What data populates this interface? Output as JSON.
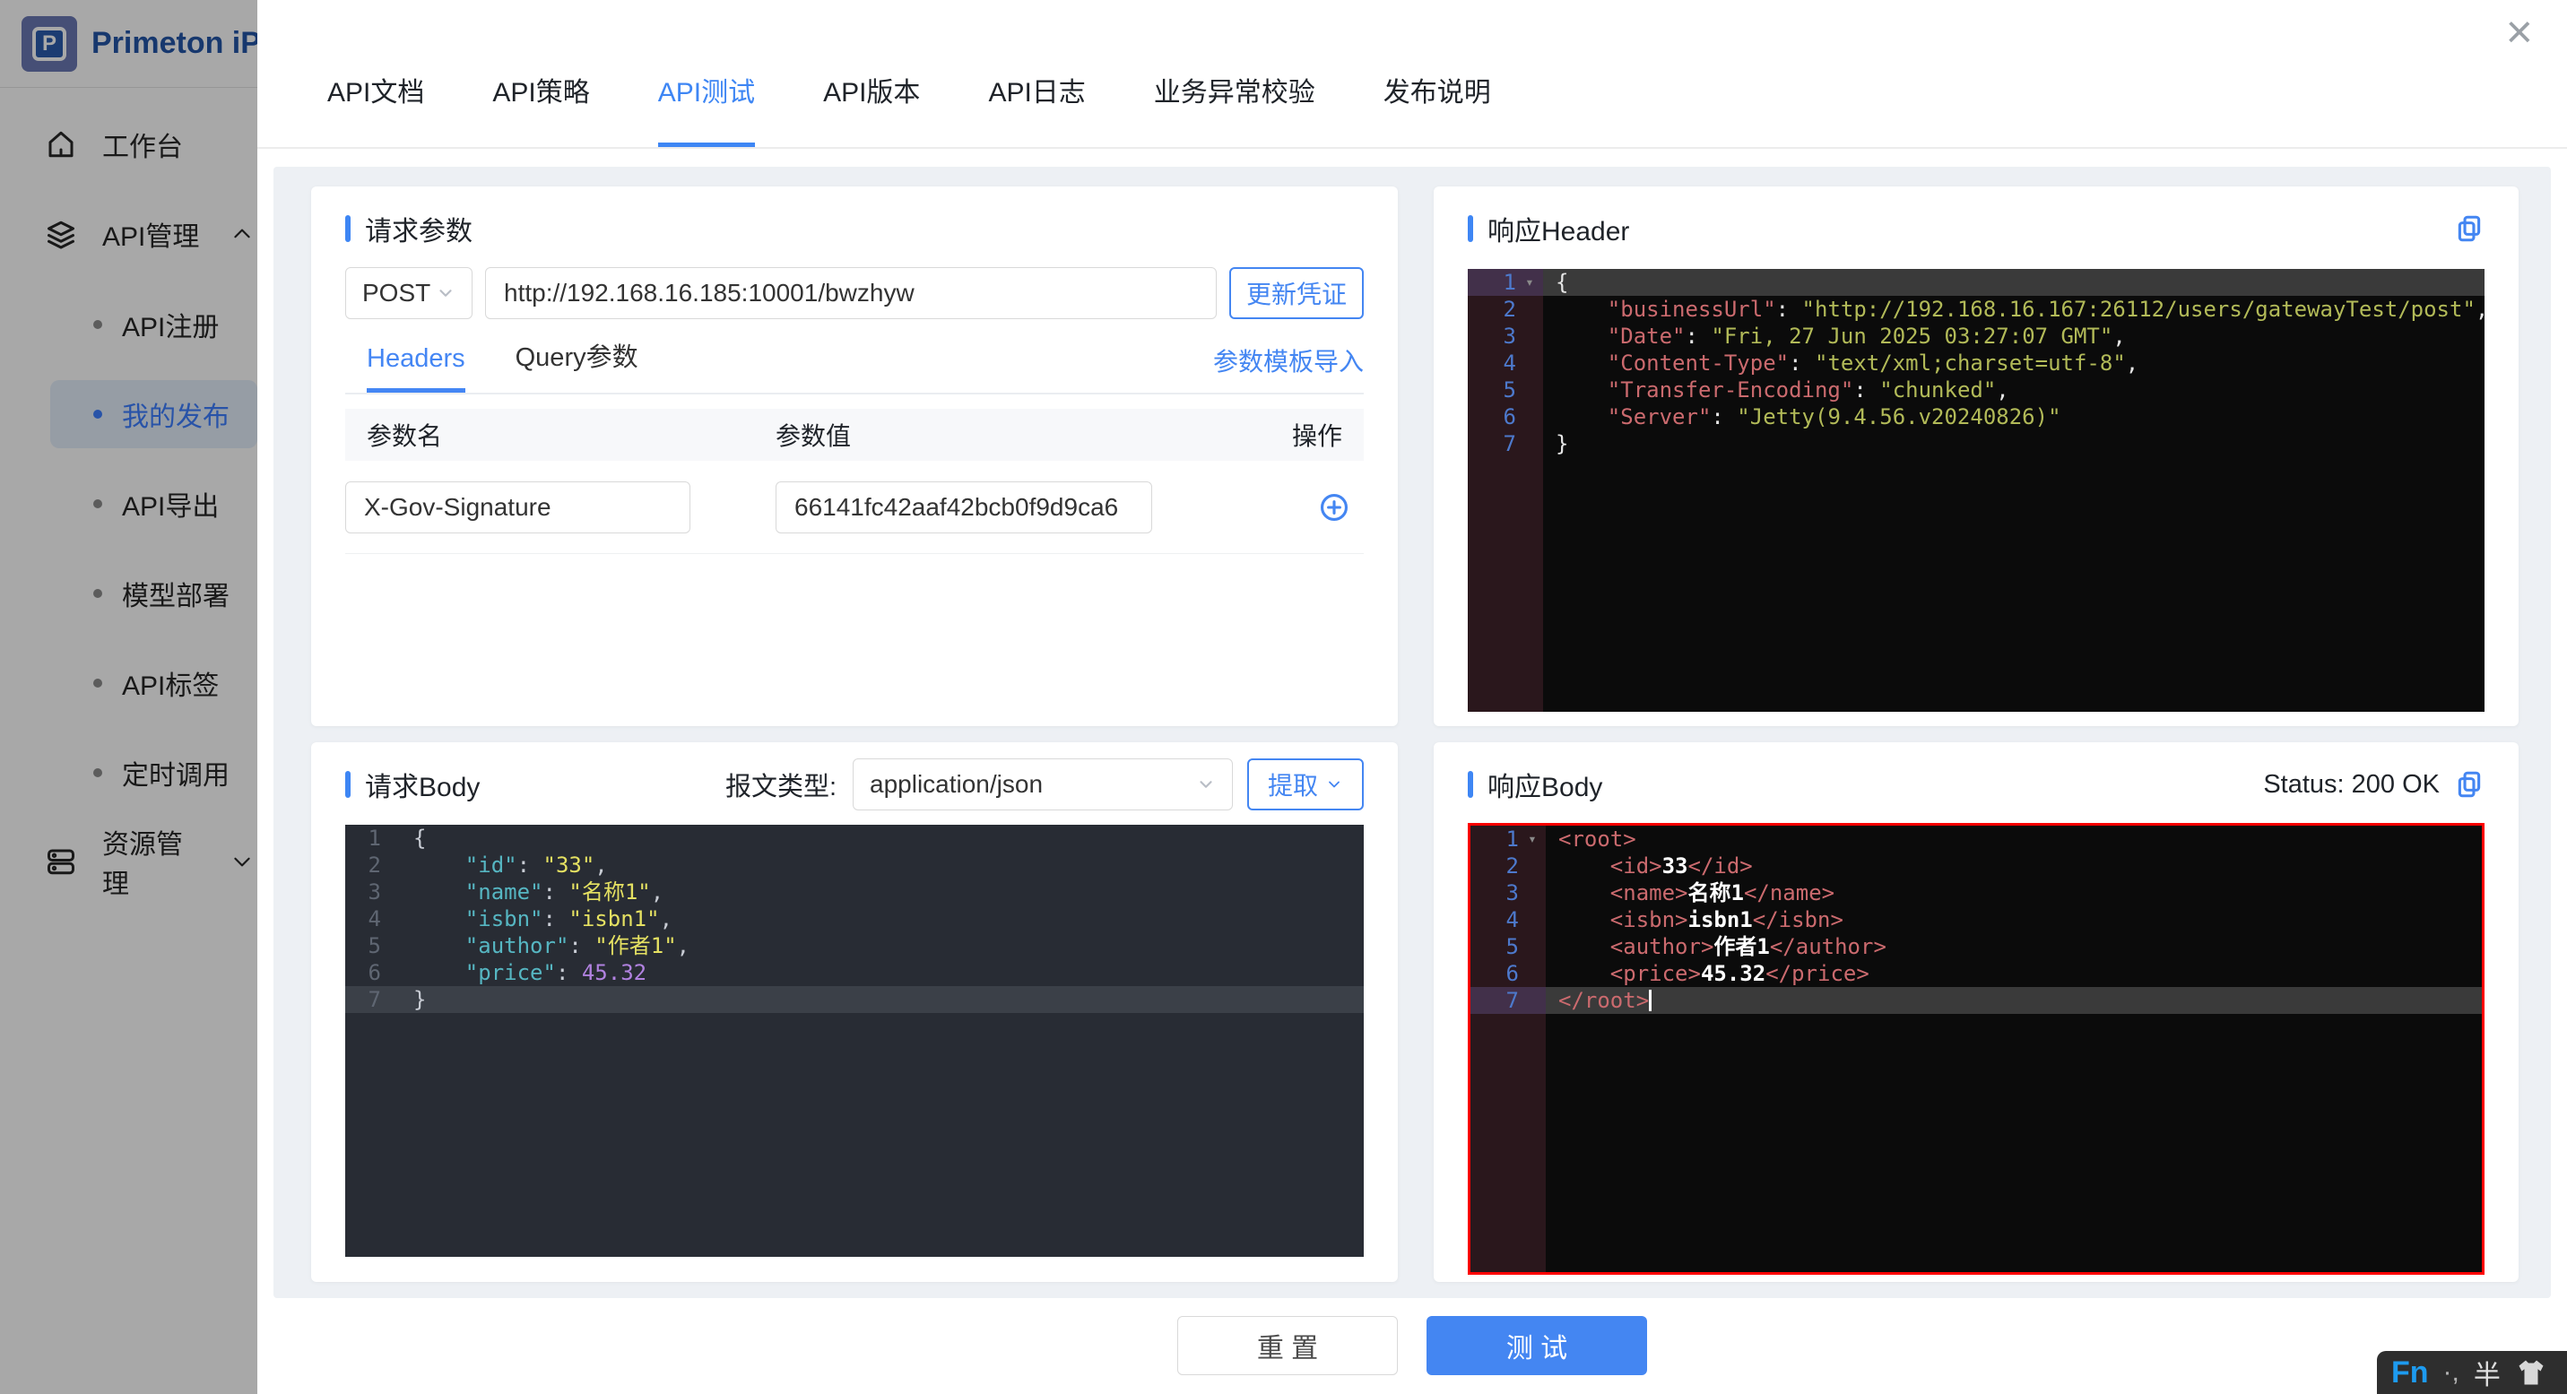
{
  "sidebar": {
    "logo_letter": "P",
    "logo_text": "Primeton iP",
    "items": [
      {
        "label": "工作台"
      },
      {
        "label": "API管理"
      },
      {
        "label": "API注册"
      },
      {
        "label": "我的发布"
      },
      {
        "label": "API导出"
      },
      {
        "label": "模型部署"
      },
      {
        "label": "API标签"
      },
      {
        "label": "定时调用"
      },
      {
        "label": "资源管理"
      }
    ]
  },
  "modal": {
    "close": "×",
    "tabs": [
      "API文档",
      "API策略",
      "API测试",
      "API版本",
      "API日志",
      "业务异常校验",
      "发布说明"
    ],
    "request_params": {
      "title": "请求参数",
      "method": "POST",
      "url": "http://192.168.16.185:10001/bwzhyw",
      "update_credential": "更新凭证",
      "tab_headers": "Headers",
      "tab_query": "Query参数",
      "template_import": "参数模板导入",
      "col_name": "参数名",
      "col_value": "参数值",
      "col_action": "操作",
      "row_name": "X-Gov-Signature",
      "row_value": "66141fc42aaf42bcb0f9d9ca6"
    },
    "response_header": {
      "title": "响应Header"
    },
    "request_body": {
      "title": "请求Body",
      "type_label": "报文类型:",
      "content_type": "application/json",
      "extract": "提取"
    },
    "response_body": {
      "title": "响应Body",
      "status": "Status: 200 OK"
    },
    "footer": {
      "reset": "重 置",
      "test": "测 试"
    }
  },
  "editors": {
    "respHeader": {
      "theme": "black",
      "activeLine": 1,
      "foldLine": 1,
      "lines": [
        [
          {
            "c": "p",
            "t": "{"
          }
        ],
        [
          {
            "c": "p",
            "t": "    "
          },
          {
            "c": "key",
            "t": "\"businessUrl\""
          },
          {
            "c": "p",
            "t": ": "
          },
          {
            "c": "str",
            "t": "\"http://192.168.16.167:26112/users/gatewayTest/post\""
          },
          {
            "c": "p",
            "t": ","
          }
        ],
        [
          {
            "c": "p",
            "t": "    "
          },
          {
            "c": "key",
            "t": "\"Date\""
          },
          {
            "c": "p",
            "t": ": "
          },
          {
            "c": "str",
            "t": "\"Fri, 27 Jun 2025 03:27:07 GMT\""
          },
          {
            "c": "p",
            "t": ","
          }
        ],
        [
          {
            "c": "p",
            "t": "    "
          },
          {
            "c": "key",
            "t": "\"Content-Type\""
          },
          {
            "c": "p",
            "t": ": "
          },
          {
            "c": "str",
            "t": "\"text/xml;charset=utf-8\""
          },
          {
            "c": "p",
            "t": ","
          }
        ],
        [
          {
            "c": "p",
            "t": "    "
          },
          {
            "c": "key",
            "t": "\"Transfer-Encoding\""
          },
          {
            "c": "p",
            "t": ": "
          },
          {
            "c": "str",
            "t": "\"chunked\""
          },
          {
            "c": "p",
            "t": ","
          }
        ],
        [
          {
            "c": "p",
            "t": "    "
          },
          {
            "c": "key",
            "t": "\"Server\""
          },
          {
            "c": "p",
            "t": ": "
          },
          {
            "c": "str",
            "t": "\"Jetty(9.4.56.v20240826)\""
          }
        ],
        [
          {
            "c": "p",
            "t": "}"
          }
        ]
      ]
    },
    "reqBody": {
      "theme": "onedark",
      "activeLine": 7,
      "lines": [
        [
          {
            "c": "p",
            "t": "{"
          }
        ],
        [
          {
            "c": "p",
            "t": "    "
          },
          {
            "c": "key",
            "t": "\"id\""
          },
          {
            "c": "p",
            "t": ": "
          },
          {
            "c": "str",
            "t": "\"33\""
          },
          {
            "c": "p",
            "t": ","
          }
        ],
        [
          {
            "c": "p",
            "t": "    "
          },
          {
            "c": "key",
            "t": "\"name\""
          },
          {
            "c": "p",
            "t": ": "
          },
          {
            "c": "str",
            "t": "\"名称1\""
          },
          {
            "c": "p",
            "t": ","
          }
        ],
        [
          {
            "c": "p",
            "t": "    "
          },
          {
            "c": "key",
            "t": "\"isbn\""
          },
          {
            "c": "p",
            "t": ": "
          },
          {
            "c": "str",
            "t": "\"isbn1\""
          },
          {
            "c": "p",
            "t": ","
          }
        ],
        [
          {
            "c": "p",
            "t": "    "
          },
          {
            "c": "key",
            "t": "\"author\""
          },
          {
            "c": "p",
            "t": ": "
          },
          {
            "c": "str",
            "t": "\"作者1\""
          },
          {
            "c": "p",
            "t": ","
          }
        ],
        [
          {
            "c": "p",
            "t": "    "
          },
          {
            "c": "key",
            "t": "\"price\""
          },
          {
            "c": "p",
            "t": ": "
          },
          {
            "c": "num",
            "t": "45.32"
          }
        ],
        [
          {
            "c": "p",
            "t": "}"
          }
        ]
      ]
    },
    "respBody": {
      "theme": "black",
      "activeLine": 7,
      "foldLine": 1,
      "cursorLine": 7,
      "lines": [
        [
          {
            "c": "tag",
            "t": "<root>"
          }
        ],
        [
          {
            "c": "p",
            "t": "    "
          },
          {
            "c": "tag",
            "t": "<id>"
          },
          {
            "c": "txt",
            "t": "33"
          },
          {
            "c": "tag",
            "t": "</id>"
          }
        ],
        [
          {
            "c": "p",
            "t": "    "
          },
          {
            "c": "tag",
            "t": "<name>"
          },
          {
            "c": "txt",
            "t": "名称1"
          },
          {
            "c": "tag",
            "t": "</name>"
          }
        ],
        [
          {
            "c": "p",
            "t": "    "
          },
          {
            "c": "tag",
            "t": "<isbn>"
          },
          {
            "c": "txt",
            "t": "isbn1"
          },
          {
            "c": "tag",
            "t": "</isbn>"
          }
        ],
        [
          {
            "c": "p",
            "t": "    "
          },
          {
            "c": "tag",
            "t": "<author>"
          },
          {
            "c": "txt",
            "t": "作者1"
          },
          {
            "c": "tag",
            "t": "</author>"
          }
        ],
        [
          {
            "c": "p",
            "t": "    "
          },
          {
            "c": "tag",
            "t": "<price>"
          },
          {
            "c": "txt",
            "t": "45.32"
          },
          {
            "c": "tag",
            "t": "</price>"
          }
        ],
        [
          {
            "c": "tag",
            "t": "</root>"
          }
        ]
      ]
    }
  },
  "ime": {
    "fn": "Fn",
    "punct": "·,",
    "half": "半"
  }
}
